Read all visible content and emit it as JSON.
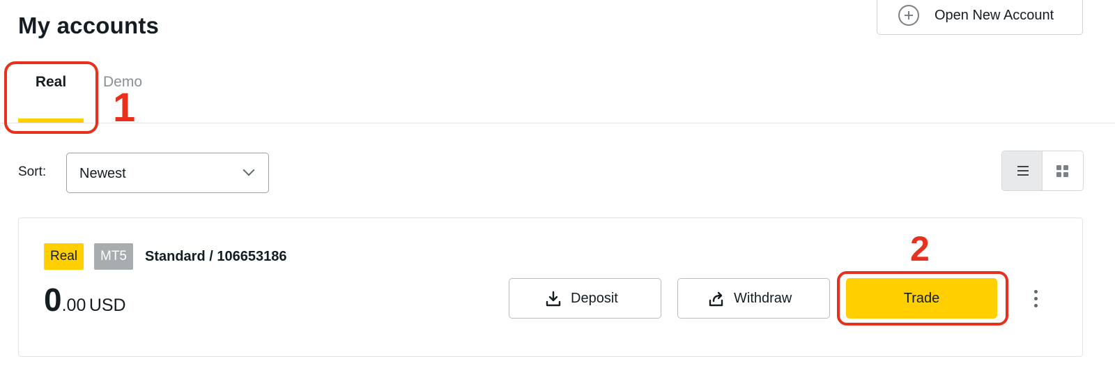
{
  "header": {
    "title": "My accounts",
    "open_account_label": "Open New Account"
  },
  "tabs": [
    {
      "label": "Real",
      "active": true
    },
    {
      "label": "Demo",
      "active": false
    }
  ],
  "annotations": {
    "step_1": "1",
    "step_2": "2",
    "highlight_color": "#e8311c"
  },
  "sort": {
    "label": "Sort:",
    "value": "Newest"
  },
  "view_toggle": {
    "options": [
      "list-icon",
      "grid-icon"
    ],
    "selected": "list"
  },
  "account": {
    "badge_type": "Real",
    "badge_platform": "MT5",
    "name": "Standard / 106653186",
    "balance_integer": "0",
    "balance_decimal": ".00",
    "balance_currency": "USD",
    "deposit_label": "Deposit",
    "withdraw_label": "Withdraw",
    "trade_label": "Trade"
  },
  "colors": {
    "accent": "#ffcf00",
    "text": "#141d22",
    "muted": "#8a9196"
  }
}
